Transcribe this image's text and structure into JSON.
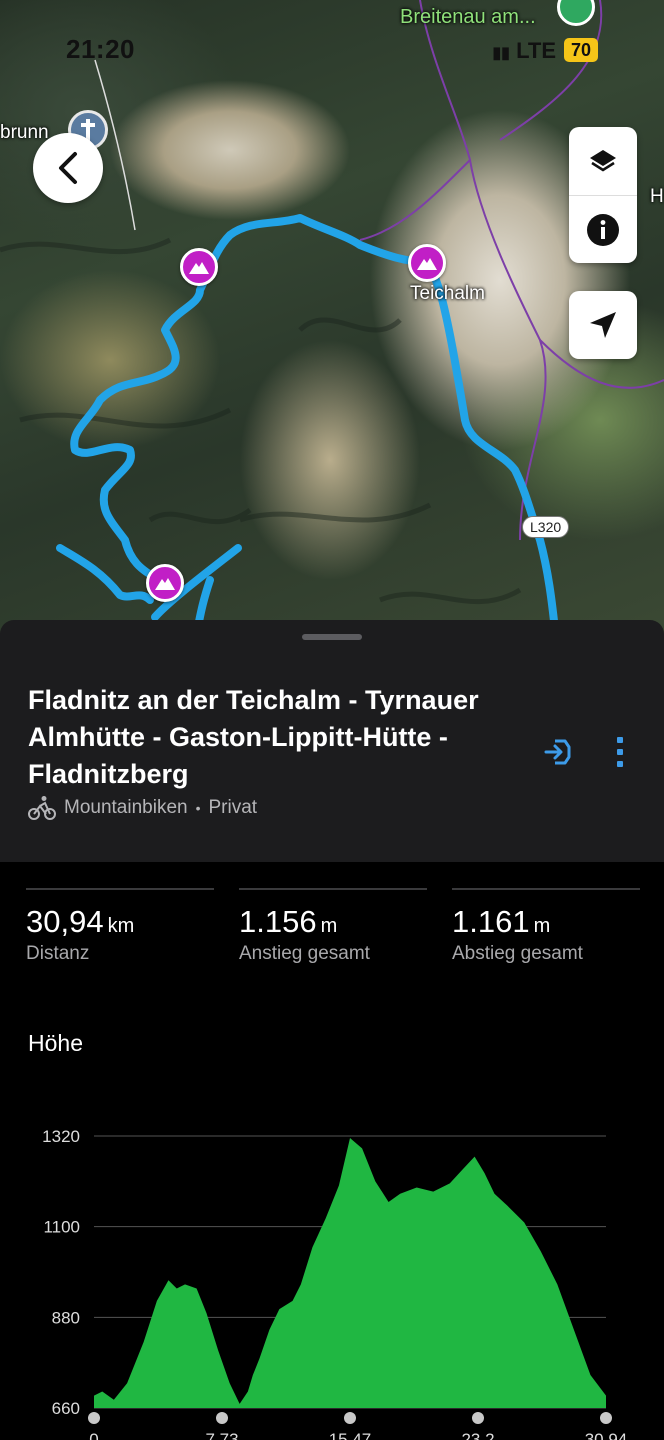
{
  "status_bar": {
    "time": "21:20",
    "network": "LTE",
    "battery": "70"
  },
  "map": {
    "labels": {
      "breitenau": "Breitenau am...",
      "brunn": "brunn",
      "teichalm": "Teichalm",
      "edge_h": "H",
      "road_l320": "L320"
    }
  },
  "route": {
    "title": "Fladnitz an der Teichalm - Tyrnauer Almhütte - Gaston-Lippitt-Hütte - Fladnitzberg",
    "activity": "Mountainbiken",
    "separator": "•",
    "visibility": "Privat"
  },
  "stats": [
    {
      "value": "30,94",
      "unit": "km",
      "label": "Distanz"
    },
    {
      "value": "1.156",
      "unit": "m",
      "label": "Anstieg gesamt"
    },
    {
      "value": "1.161",
      "unit": "m",
      "label": "Abstieg gesamt"
    }
  ],
  "elevation": {
    "title": "Höhe"
  },
  "colors": {
    "route": "#22a4e8",
    "poi": "#c11fc6",
    "profile_fill": "#20b742",
    "sheet_bg": "#1c1c1e",
    "accent": "#3d9be9"
  },
  "chart_data": {
    "type": "area",
    "title": "Höhe",
    "xlabel": "",
    "ylabel": "",
    "y_ticks": [
      660,
      880,
      1100,
      1320
    ],
    "x_ticks": [
      "0",
      "7,73",
      "15,47",
      "23,2",
      "30,94"
    ],
    "xlim": [
      0,
      30.94
    ],
    "ylim": [
      660,
      1320
    ],
    "grid": true,
    "x": [
      0,
      0.5,
      1.2,
      2.0,
      3.0,
      3.8,
      4.5,
      5.0,
      5.5,
      6.2,
      6.8,
      7.5,
      8.2,
      8.8,
      9.3,
      9.6,
      10.0,
      10.6,
      11.2,
      12.0,
      12.5,
      13.2,
      14.0,
      14.8,
      15.47,
      16.2,
      17.0,
      17.8,
      18.5,
      19.5,
      20.5,
      21.5,
      22.3,
      23.0,
      23.6,
      24.2,
      25.0,
      26.0,
      27.0,
      28.0,
      29.0,
      30.0,
      30.94
    ],
    "y": [
      690,
      700,
      680,
      720,
      820,
      920,
      970,
      950,
      960,
      950,
      890,
      800,
      720,
      670,
      700,
      740,
      780,
      850,
      900,
      920,
      960,
      1050,
      1120,
      1200,
      1315,
      1290,
      1210,
      1160,
      1180,
      1195,
      1185,
      1205,
      1240,
      1270,
      1230,
      1180,
      1150,
      1110,
      1040,
      960,
      850,
      740,
      690
    ]
  }
}
